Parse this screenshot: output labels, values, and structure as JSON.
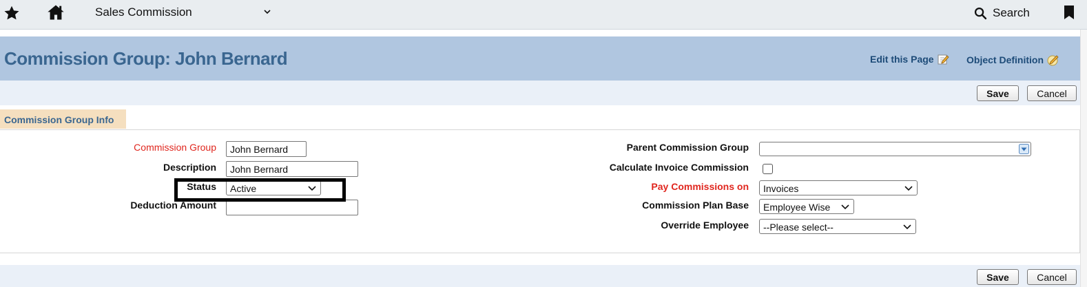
{
  "topbar": {
    "app_title": "Sales Commission",
    "search_label": "Search",
    "icons": [
      "star-icon",
      "home-icon",
      "chevron-down-icon",
      "search-icon",
      "bookmark-icon"
    ]
  },
  "header": {
    "title": "Commission Group: John Bernard",
    "edit_link": "Edit this Page",
    "object_link": "Object Definition"
  },
  "buttons": {
    "save": "Save",
    "cancel": "Cancel"
  },
  "section": {
    "title": "Commission Group Info"
  },
  "form": {
    "commission_group": {
      "label": "Commission Group",
      "value": "John Bernard",
      "required": true
    },
    "description": {
      "label": "Description",
      "value": "John Bernard"
    },
    "status": {
      "label": "Status",
      "value": "Active"
    },
    "deduction_amount": {
      "label": "Deduction Amount",
      "value": ""
    },
    "parent_commission_group": {
      "label": "Parent Commission Group",
      "value": ""
    },
    "calculate_invoice_commission": {
      "label": "Calculate Invoice Commission",
      "checked": false
    },
    "pay_commissions_on": {
      "label": "Pay Commissions on",
      "value": "Invoices",
      "required": true
    },
    "commission_plan_base": {
      "label": "Commission Plan Base",
      "value": "Employee Wise"
    },
    "override_employee": {
      "label": "Override Employee",
      "value": "--Please select--"
    }
  },
  "colors": {
    "header_band": "#b0c6e0",
    "title_text": "#3a6690",
    "required_label": "#e0261e",
    "section_tab": "#f5dfbf",
    "button_bar": "#eaf0f8"
  }
}
